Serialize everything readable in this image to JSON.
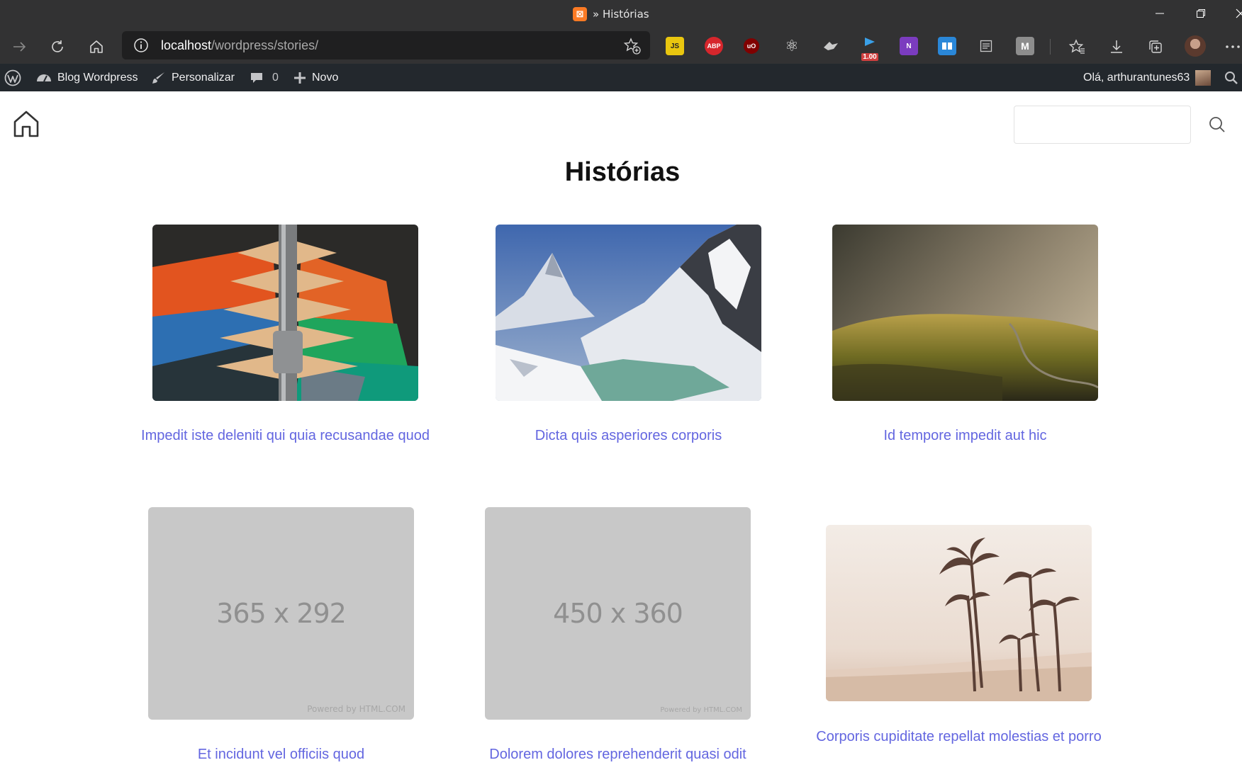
{
  "browser": {
    "tab_title": "» Histórias",
    "tab_logo_glyph": "⊠",
    "url_host": "localhost",
    "url_path": "/wordpress/stories/",
    "extensions": [
      {
        "name": "js-extension",
        "label": "JS",
        "color": "#e9c60f"
      },
      {
        "name": "adblock-plus",
        "label": "ABP",
        "color": "#d6262c"
      },
      {
        "name": "ublock",
        "label": "uO",
        "color": "#800000"
      },
      {
        "name": "react-devtools",
        "label": "⚛",
        "color": "transparent"
      },
      {
        "name": "wappalyzer",
        "label": "",
        "color": "transparent"
      },
      {
        "name": "speed-extension",
        "label": "1.00",
        "color": "#d13f3f"
      },
      {
        "name": "onenote",
        "label": "N",
        "color": "#7b3cbf"
      },
      {
        "name": "reader-extension",
        "label": "",
        "color": "#2a87d8"
      },
      {
        "name": "reading-list",
        "label": "",
        "color": "transparent"
      },
      {
        "name": "m-extension",
        "label": "M",
        "color": "#8d8d8d"
      }
    ]
  },
  "adminbar": {
    "site_name": "Blog Wordpress",
    "customize": "Personalizar",
    "comments_count": "0",
    "new": "Novo",
    "greeting": "Olá, arthurantunes63"
  },
  "page": {
    "title": "Histórias",
    "stories": [
      {
        "title": "Impedit iste deleniti qui quia recusandae quod",
        "image": "photo-clothes-hangers"
      },
      {
        "title": "Dicta quis asperiores corporis",
        "image": "photo-snowy-mountains-lake"
      },
      {
        "title": "Id tempore impedit aut hic",
        "image": "photo-foggy-hills"
      },
      {
        "title": "Et incidunt vel officiis quod",
        "image": "placeholder",
        "placeholder_text": "365 x 292",
        "powered": "Powered by HTML.COM"
      },
      {
        "title": "Dolorem dolores reprehenderit quasi odit",
        "image": "placeholder",
        "placeholder_text": "450 x 360",
        "powered": "Powered by HTML.COM"
      },
      {
        "title": "Corporis cupiditate repellat molestias et porro",
        "image": "photo-palm-trees-beach"
      }
    ]
  }
}
